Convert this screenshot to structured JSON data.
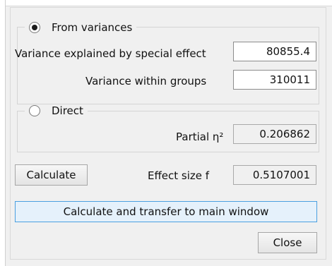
{
  "from_variances": {
    "label": "From variances",
    "selected": true,
    "variance_special_label": "Variance explained by special effect",
    "variance_special_value": "80855.4",
    "variance_within_label": "Variance within groups",
    "variance_within_value": "310011"
  },
  "direct": {
    "label": "Direct",
    "selected": false,
    "partial_eta_label": "Partial η²",
    "partial_eta_value": "0.206862"
  },
  "calculate": {
    "button_label": "Calculate",
    "effect_size_label": "Effect size f",
    "effect_size_value": "0.5107001"
  },
  "transfer_button_label": "Calculate and transfer to main window",
  "close_button_label": "Close"
}
